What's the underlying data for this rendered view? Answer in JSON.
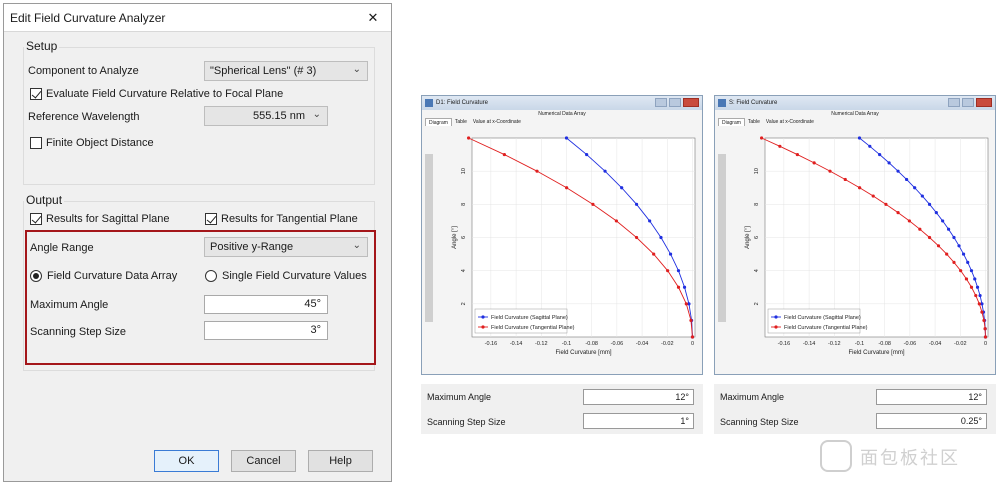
{
  "dialog": {
    "title": "Edit Field Curvature Analyzer",
    "setup_title": "Setup",
    "component_label": "Component to Analyze",
    "component_value": "\"Spherical Lens\" (# 3)",
    "evaluate_label": "Evaluate Field Curvature Relative to Focal Plane",
    "evaluate_checked": true,
    "ref_wavelength_label": "Reference Wavelength",
    "ref_wavelength_value": "555.15 nm",
    "finite_label": "Finite Object Distance",
    "finite_checked": false,
    "output_title": "Output",
    "sagittal_label": "Results for Sagittal Plane",
    "tangential_label": "Results for Tangential Plane",
    "angle_range_label": "Angle Range",
    "angle_range_value": "Positive y-Range",
    "radio_array_label": "Field Curvature Data Array",
    "radio_single_label": "Single Field Curvature Values",
    "max_angle_label": "Maximum Angle",
    "max_angle_value": "45°",
    "step_label": "Scanning Step Size",
    "step_value": "3°",
    "ok_label": "OK",
    "cancel_label": "Cancel",
    "help_label": "Help"
  },
  "plot_windows": [
    {
      "title": "D1: Field Curvature",
      "subtitle": "Numerical Data Array",
      "tabs": [
        "Diagram",
        "Table",
        "Value at x-Coordinate"
      ],
      "param_max_angle_label": "Maximum Angle",
      "param_max_angle_value": "12°",
      "param_step_label": "Scanning Step Size",
      "param_step_value": "1°"
    },
    {
      "title": "S: Field Curvature",
      "subtitle": "Numerical Data Array",
      "tabs": [
        "Diagram",
        "Table",
        "Value at x-Coordinate"
      ],
      "param_max_angle_label": "Maximum Angle",
      "param_max_angle_value": "12°",
      "param_step_label": "Scanning Step Size",
      "param_step_value": "0.25°"
    }
  ],
  "chart_data": [
    {
      "type": "line",
      "xlabel": "Field Curvature [mm]",
      "ylabel": "Angle [°]",
      "xlim": [
        -0.175,
        0.002
      ],
      "ylim": [
        0,
        12
      ],
      "xticks": [
        -0.16,
        -0.14,
        -0.12,
        -0.1,
        -0.08,
        -0.06,
        -0.04,
        -0.02,
        0
      ],
      "xtick_labels": [
        "-0.16",
        "-0.14",
        "-0.12",
        "-0.1",
        "-0.08",
        "-0.06",
        "-0.04",
        "-0.02",
        "0"
      ],
      "yticks": [
        2,
        4,
        6,
        8,
        10
      ],
      "ytick_labels": [
        "2",
        "4",
        "6",
        "8",
        "10"
      ],
      "grid": true,
      "legend_position": "bottom-left",
      "series": [
        {
          "name": "Field Curvature (Sagittal Plane)",
          "color": "#1f2fe0",
          "x": [
            0,
            -0.0007,
            -0.0028,
            -0.0063,
            -0.0111,
            -0.0174,
            -0.025,
            -0.034,
            -0.0444,
            -0.0562,
            -0.0694,
            -0.084,
            -0.1
          ],
          "y": [
            0,
            1,
            2,
            3,
            4,
            5,
            6,
            7,
            8,
            9,
            10,
            11,
            12
          ]
        },
        {
          "name": "Field Curvature (Tangential Plane)",
          "color": "#e01f1f",
          "x": [
            0,
            -0.0012,
            -0.0049,
            -0.0111,
            -0.0197,
            -0.0308,
            -0.0444,
            -0.0604,
            -0.079,
            -0.0999,
            -0.1234,
            -0.1493,
            -0.1777
          ],
          "y": [
            0,
            1,
            2,
            3,
            4,
            5,
            6,
            7,
            8,
            9,
            10,
            11,
            12
          ]
        }
      ]
    },
    {
      "type": "line",
      "xlabel": "Field Curvature [mm]",
      "ylabel": "Angle [°]",
      "xlim": [
        -0.175,
        0.002
      ],
      "ylim": [
        0,
        12
      ],
      "xticks": [
        -0.16,
        -0.14,
        -0.12,
        -0.1,
        -0.08,
        -0.06,
        -0.04,
        -0.02,
        0
      ],
      "xtick_labels": [
        "-0.16",
        "-0.14",
        "-0.12",
        "-0.1",
        "-0.08",
        "-0.06",
        "-0.04",
        "-0.02",
        "0"
      ],
      "yticks": [
        2,
        4,
        6,
        8,
        10
      ],
      "ytick_labels": [
        "2",
        "4",
        "6",
        "8",
        "10"
      ],
      "grid": true,
      "legend_position": "bottom-left",
      "series": [
        {
          "name": "Field Curvature (Sagittal Plane)",
          "color": "#1f2fe0",
          "x": [
            0,
            -0.0002,
            -0.0007,
            -0.0016,
            -0.0028,
            -0.0043,
            -0.0063,
            -0.0085,
            -0.0111,
            -0.0141,
            -0.0174,
            -0.021,
            -0.025,
            -0.0293,
            -0.034,
            -0.039,
            -0.0444,
            -0.0501,
            -0.0562,
            -0.0626,
            -0.0694,
            -0.0765,
            -0.084,
            -0.0918,
            -0.1
          ],
          "y": [
            0,
            0.5,
            1,
            1.5,
            2,
            2.5,
            3,
            3.5,
            4,
            4.5,
            5,
            5.5,
            6,
            6.5,
            7,
            7.5,
            8,
            8.5,
            9,
            9.5,
            10,
            10.5,
            11,
            11.5,
            12
          ]
        },
        {
          "name": "Field Curvature (Tangential Plane)",
          "color": "#e01f1f",
          "x": [
            0,
            -0.0003,
            -0.0012,
            -0.0028,
            -0.0049,
            -0.0077,
            -0.0111,
            -0.0151,
            -0.0197,
            -0.025,
            -0.0308,
            -0.0373,
            -0.0444,
            -0.0521,
            -0.0604,
            -0.0694,
            -0.079,
            -0.0891,
            -0.0999,
            -0.1113,
            -0.1234,
            -0.136,
            -0.1493,
            -0.1632,
            -0.1777
          ],
          "y": [
            0,
            0.5,
            1,
            1.5,
            2,
            2.5,
            3,
            3.5,
            4,
            4.5,
            5,
            5.5,
            6,
            6.5,
            7,
            7.5,
            8,
            8.5,
            9,
            9.5,
            10,
            10.5,
            11,
            11.5,
            12
          ]
        }
      ]
    }
  ],
  "watermark": {
    "text": "面包板社区"
  }
}
